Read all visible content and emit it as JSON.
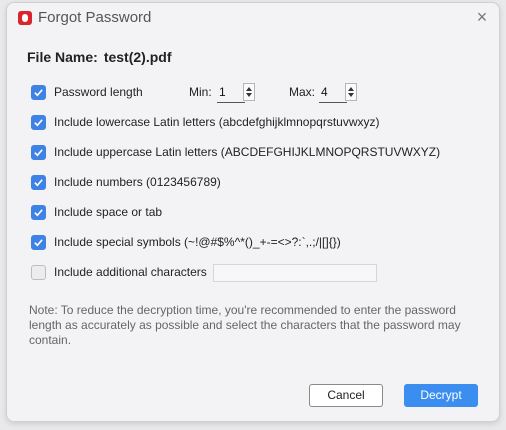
{
  "window": {
    "title": "Forgot Password",
    "close_glyph": "×"
  },
  "file": {
    "label": "File Name:",
    "name": "test(2).pdf"
  },
  "options": {
    "password_length": {
      "label": "Password length",
      "checked": true,
      "min_label": "Min:",
      "min_value": "1",
      "max_label": "Max:",
      "max_value": "4"
    },
    "lowercase": {
      "label": "Include lowercase Latin letters (abcdefghijklmnopqrstuvwxyz)",
      "checked": true
    },
    "uppercase": {
      "label": "Include uppercase Latin letters (ABCDEFGHIJKLMNOPQRSTUVWXYZ)",
      "checked": true
    },
    "numbers": {
      "label": "Include numbers (0123456789)",
      "checked": true
    },
    "space_tab": {
      "label": "Include space or tab",
      "checked": true
    },
    "special": {
      "label": "Include special symbols (~!@#$%^*()_+-=<>?:`,.;/|[]{})",
      "checked": true
    },
    "additional": {
      "label": "Include additional characters",
      "checked": false,
      "value": ""
    }
  },
  "note": "Note: To reduce the decryption time, you're recommended to enter the password length as accurately as possible and select the characters that the password may contain.",
  "buttons": {
    "cancel": "Cancel",
    "decrypt": "Decrypt"
  },
  "colors": {
    "accent": "#3e82e6",
    "primary_button": "#3b8ef0",
    "app_icon": "#d9262e"
  }
}
